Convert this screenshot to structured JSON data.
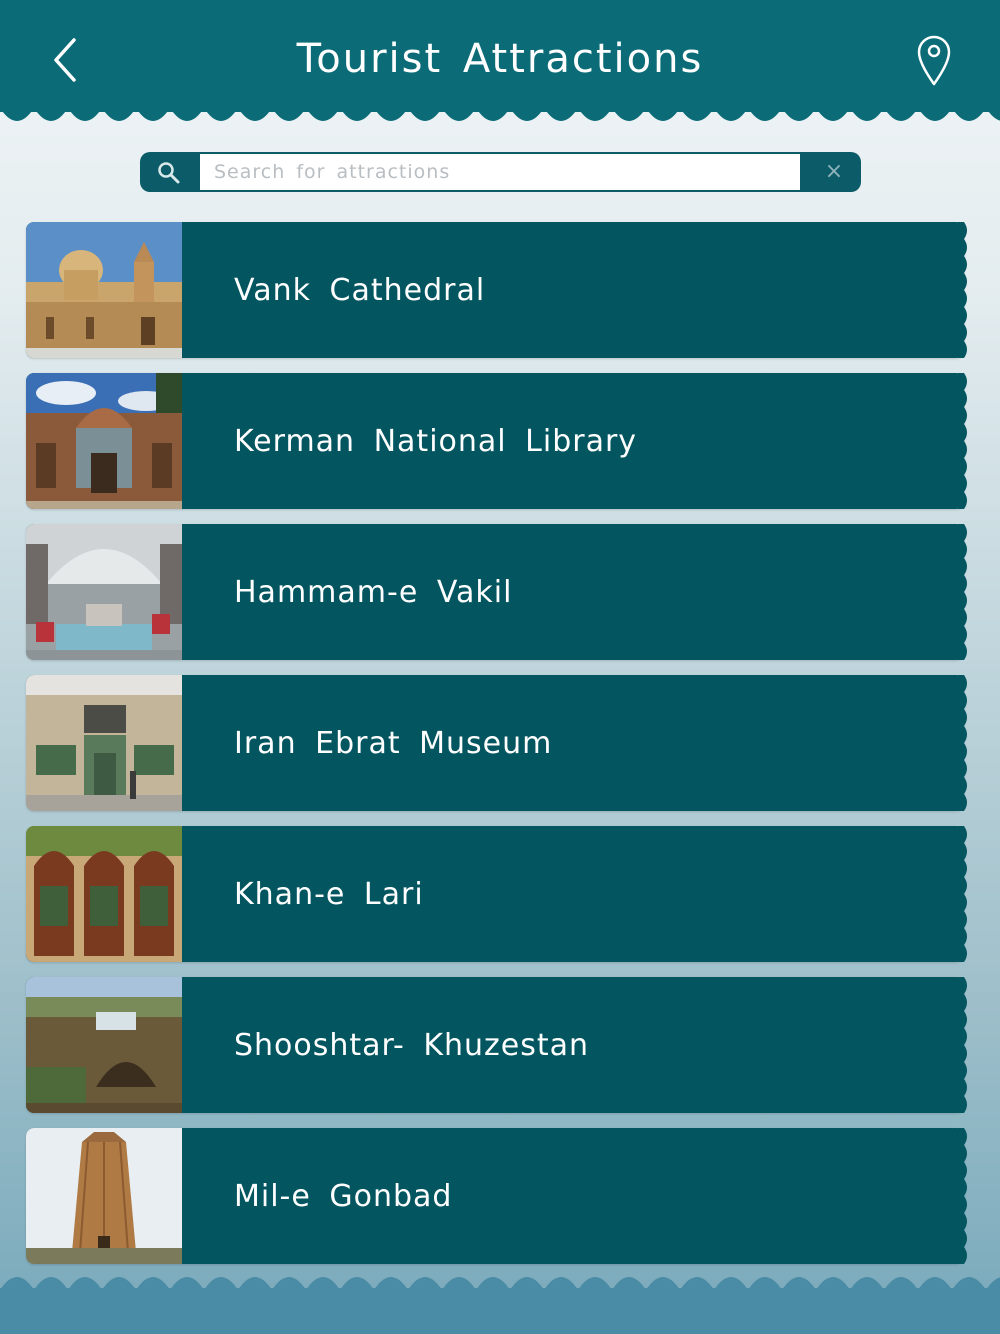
{
  "header": {
    "title": "Tourist Attractions",
    "back_icon": "chevron-left-icon",
    "map_icon": "map-pin-icon"
  },
  "search": {
    "placeholder": "Search for attractions",
    "value": "",
    "clear_label": "×"
  },
  "attractions": [
    {
      "name": "Vank Cathedral"
    },
    {
      "name": "Kerman National Library"
    },
    {
      "name": "Hammam-e Vakil"
    },
    {
      "name": "Iran Ebrat Museum"
    },
    {
      "name": "Khan-e Lari"
    },
    {
      "name": "Shooshtar- Khuzestan"
    },
    {
      "name": "Mil-e Gonbad"
    }
  ],
  "colors": {
    "header": "#0b6c78",
    "item_background": "#035560",
    "footer": "#4a8ba6"
  }
}
